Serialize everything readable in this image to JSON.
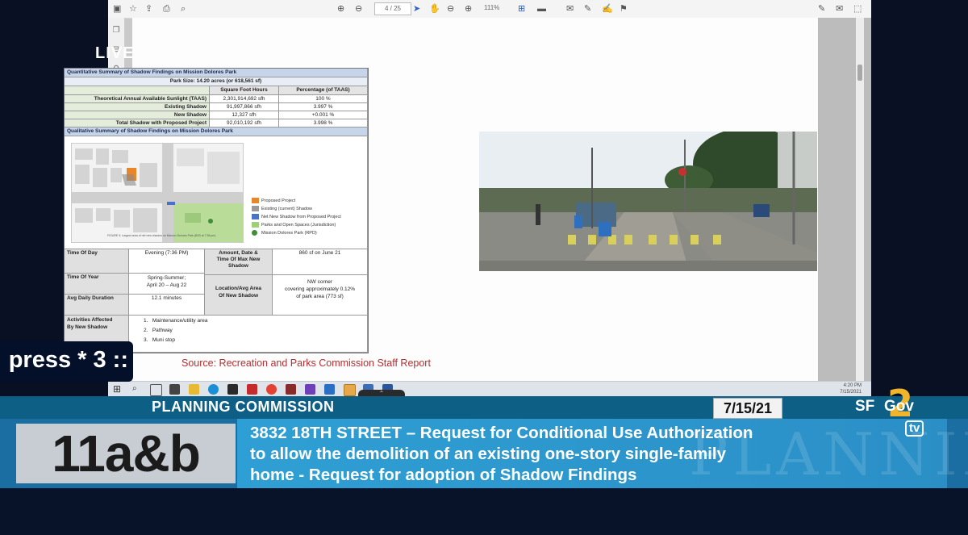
{
  "overlay": {
    "live_label": "LIVE",
    "ticker_text": "press * 3 ::"
  },
  "viewer": {
    "page_indicator": "4 / 25",
    "zoom_value": "111%",
    "clock_time": "4:20 PM",
    "clock_date": "7/15/2021"
  },
  "document": {
    "quant_title": "Quantitative Summary of Shadow Findings on Mission Dolores Park",
    "park_size": "Park Size: 14.20 acres (or 618,561 sf)",
    "col_sfh": "Square Foot Hours",
    "col_pct": "Percentage (of TAAS)",
    "rows": [
      {
        "label": "Theoretical Annual Available Sunlight (TAAS)",
        "sfh": "2,301,914,692 sfh",
        "pct": "100 %"
      },
      {
        "label": "Existing Shadow",
        "sfh": "91,997,866 sfh",
        "pct": "3.997 %"
      },
      {
        "label": "New Shadow",
        "sfh": "12,327 sfh",
        "pct": "+0.001 %"
      },
      {
        "label": "Total Shadow with Proposed Project",
        "sfh": "92,010,192 sfh",
        "pct": "3.998 %"
      }
    ],
    "qual_title": "Qualitative Summary of Shadow Findings on Mission Dolores Park",
    "legend": [
      {
        "label": "Proposed Project",
        "color": "#e8862a"
      },
      {
        "label": "Existing (current) Shadow",
        "color": "#9a9a9a"
      },
      {
        "label": "Net New Shadow from Proposed Project",
        "color": "#4a72c8"
      },
      {
        "label": "Parks and Open Spaces (Jurisdiction)",
        "color": "#9fcf7a"
      },
      {
        "label": "Mission Dolores Park (RPD)",
        "color": "#3f8f3a"
      }
    ],
    "map_caption": "FIGURE 9: Largest area of net new shadow on Mission Dolores Park (8/23 at 7:36 pm)",
    "time_of_day_label": "Time Of Day",
    "time_of_day_value": "Evening (7:36 PM)",
    "amount_label_1": "Amount, Date &",
    "amount_label_2": "Time Of Max New",
    "amount_label_3": "Shadow",
    "amount_value": "860 sf on June 21",
    "time_of_year_label": "Time Of Year",
    "time_of_year_value_1": "Spring-Summer;",
    "time_of_year_value_2": "April 20 – Aug 22",
    "location_label_1": "Location/Avg Area",
    "location_label_2": "Of New Shadow",
    "location_value_1": "NW corner",
    "location_value_2": "covering approximately 0.12%",
    "location_value_3": "of park area (773 sf)",
    "duration_label": "Avg Daily Duration",
    "duration_value": "12.1 minutes",
    "activities_label_1": "Activities Affected",
    "activities_label_2": "By New Shadow",
    "activities": [
      "Maintenance/utility area",
      "Pathway",
      "Muni stop"
    ],
    "source": "Source: Recreation and Parks Commission Staff Report"
  },
  "lower_third": {
    "commission": "PLANNING COMMISSION",
    "date": "7/15/21",
    "agenda_item": "11a&b",
    "line1": "3832 18TH STREET – Request for Conditional Use Authorization",
    "line2": "to allow the demolition of an existing one-story single-family",
    "line3": "home -  Request for adoption of Shadow Findings",
    "watermark": "PLANNING COMMISSION",
    "logo_sf": "SF",
    "logo_gov": "Gov",
    "logo_two": "2",
    "logo_tv": "tv"
  }
}
